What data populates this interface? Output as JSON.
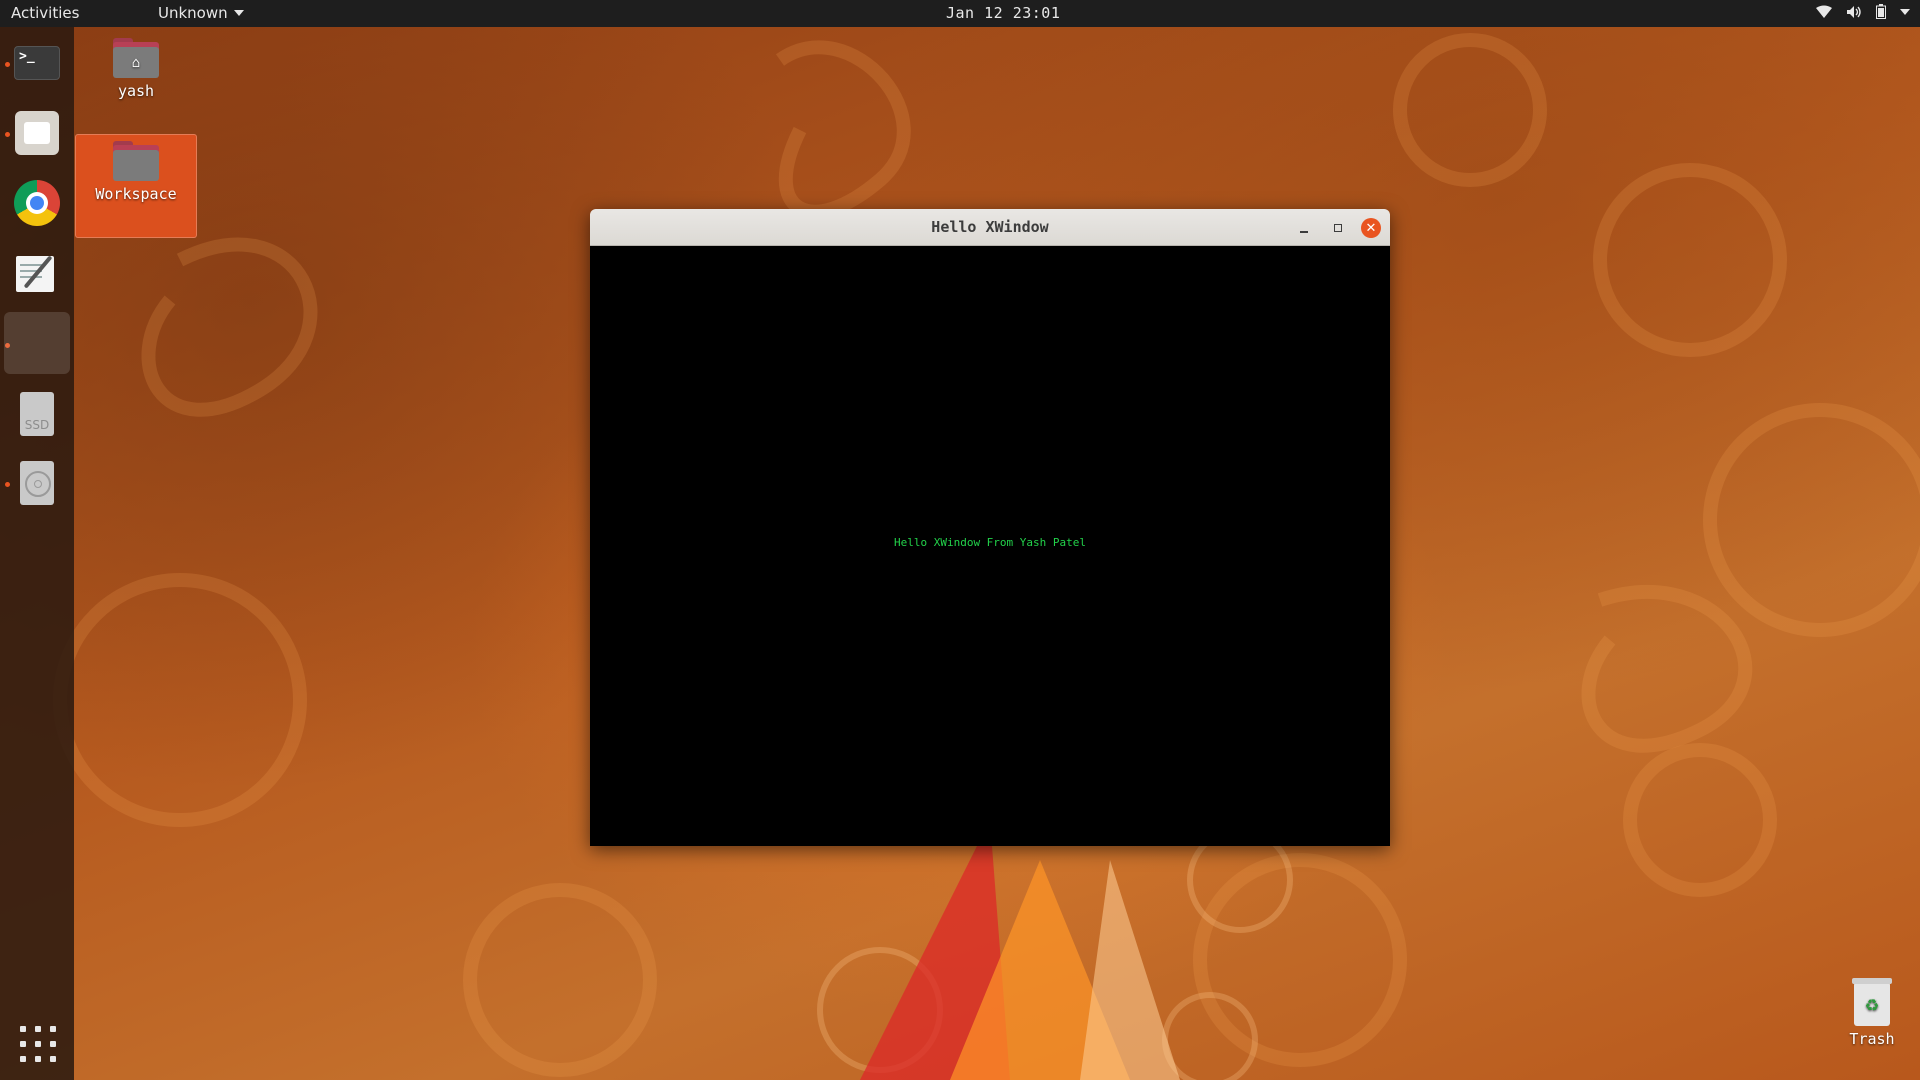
{
  "topbar": {
    "activities_label": "Activities",
    "app_menu_label": "Unknown",
    "clock": "Jan 12 23:01",
    "status_icons": [
      "wifi-icon",
      "volume-icon",
      "battery-icon",
      "system-menu-arrow-icon"
    ]
  },
  "dock": {
    "items": [
      {
        "name": "terminal",
        "running": true,
        "glyph": ">_"
      },
      {
        "name": "files",
        "running": true
      },
      {
        "name": "google-chrome",
        "running": false
      },
      {
        "name": "text-editor",
        "running": false
      },
      {
        "name": "x-window-app",
        "running": true,
        "active": true
      },
      {
        "name": "ssd-drive",
        "running": false,
        "label": "SSD"
      },
      {
        "name": "optical-disc",
        "running": true
      }
    ],
    "show_apps_icon": "app-grid-icon"
  },
  "desktop": {
    "icons": [
      {
        "label": "yash",
        "icon": "home-folder-icon",
        "selected": false
      },
      {
        "label": "Workspace",
        "icon": "folder-icon",
        "selected": true
      }
    ],
    "trash_label": "Trash"
  },
  "window": {
    "title": "Hello XWindow",
    "message": "Hello XWindow From Yash Patel",
    "message_color": "#22d14a"
  },
  "colors": {
    "accent": "#e95420",
    "topbar": "#1e1e1e",
    "client_background": "#000000"
  }
}
